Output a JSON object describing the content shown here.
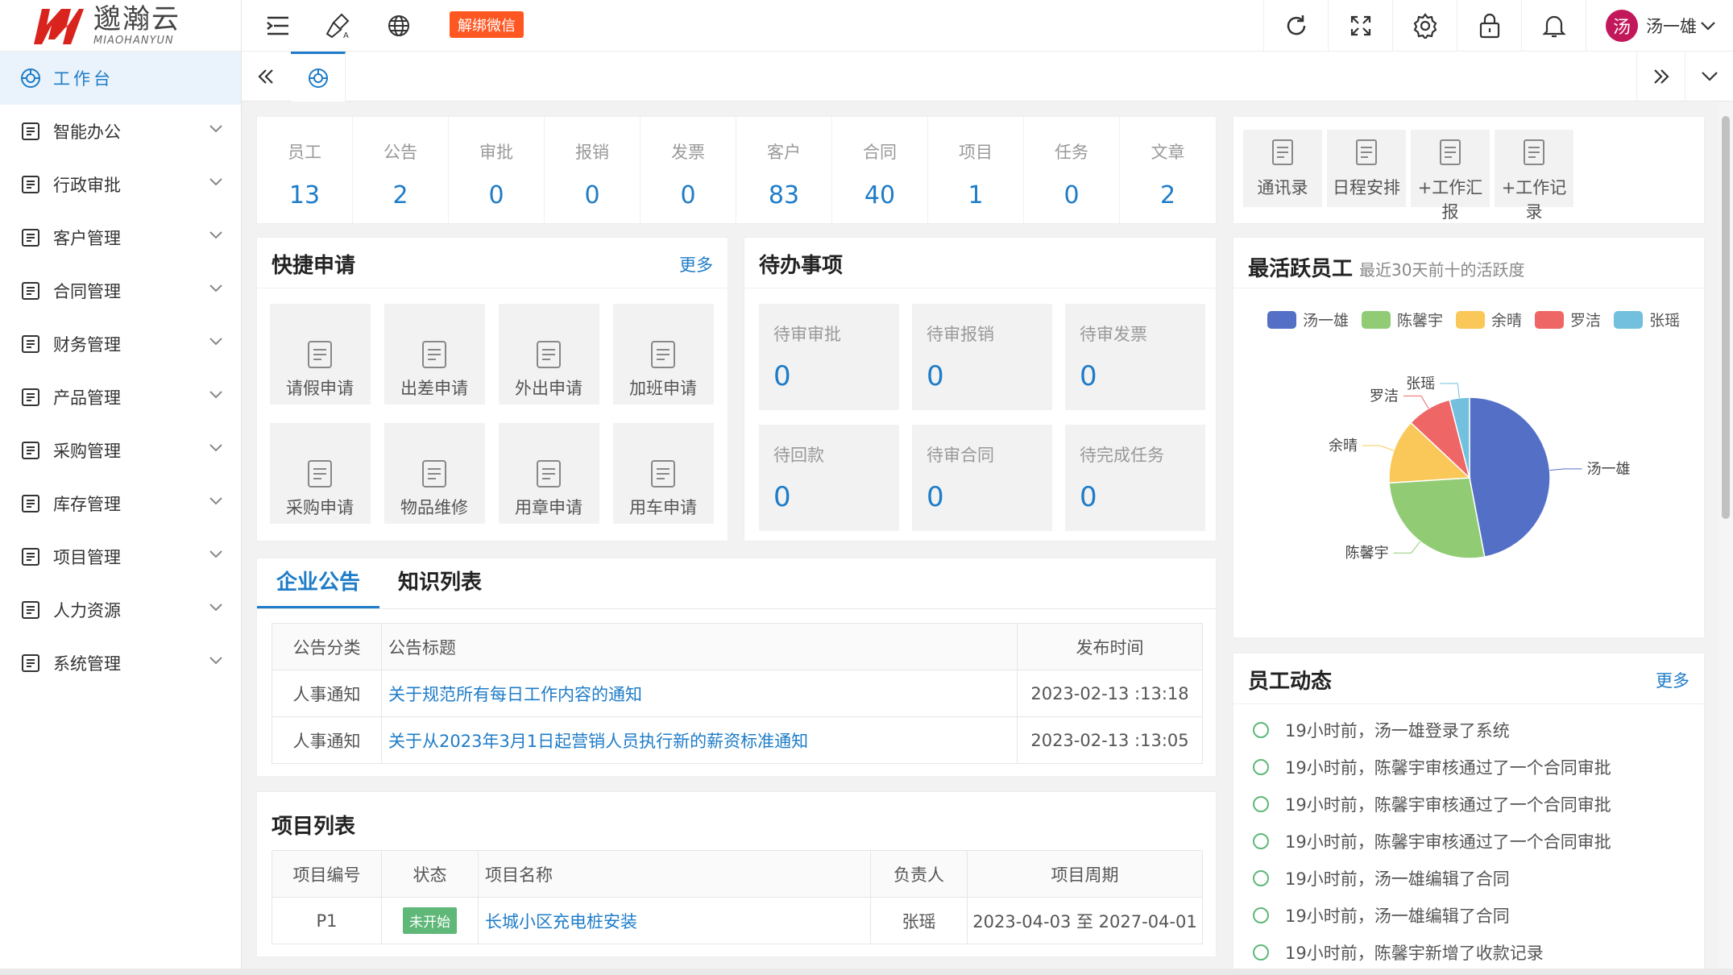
{
  "brand": {
    "name_cn": "邈瀚云",
    "name_en": "MIAOHANYUN",
    "color": "#d9231d"
  },
  "topbar": {
    "unbind_label": "解绑微信",
    "user_name": "汤一雄",
    "avatar_char": "汤"
  },
  "sidebar": {
    "items": [
      {
        "label": "工作台",
        "icon": "dashboard-icon"
      },
      {
        "label": "智能办公",
        "icon": "office-icon"
      },
      {
        "label": "行政审批",
        "icon": "approval-icon"
      },
      {
        "label": "客户管理",
        "icon": "customer-icon"
      },
      {
        "label": "合同管理",
        "icon": "contract-icon"
      },
      {
        "label": "财务管理",
        "icon": "finance-icon"
      },
      {
        "label": "产品管理",
        "icon": "product-icon"
      },
      {
        "label": "采购管理",
        "icon": "purchase-icon"
      },
      {
        "label": "库存管理",
        "icon": "inventory-icon"
      },
      {
        "label": "项目管理",
        "icon": "project-icon"
      },
      {
        "label": "人力资源",
        "icon": "hr-icon"
      },
      {
        "label": "系统管理",
        "icon": "settings-icon"
      }
    ]
  },
  "stats": [
    {
      "label": "员工",
      "value": "13"
    },
    {
      "label": "公告",
      "value": "2"
    },
    {
      "label": "审批",
      "value": "0"
    },
    {
      "label": "报销",
      "value": "0"
    },
    {
      "label": "发票",
      "value": "0"
    },
    {
      "label": "客户",
      "value": "83"
    },
    {
      "label": "合同",
      "value": "40"
    },
    {
      "label": "项目",
      "value": "1"
    },
    {
      "label": "任务",
      "value": "0"
    },
    {
      "label": "文章",
      "value": "2"
    }
  ],
  "quick_tools": [
    {
      "label": "通讯录"
    },
    {
      "label": "日程安排"
    },
    {
      "label": "+工作汇报"
    },
    {
      "label": "+工作记录"
    }
  ],
  "quick_apply": {
    "title": "快捷申请",
    "more": "更多",
    "items": [
      {
        "label": "请假申请"
      },
      {
        "label": "出差申请"
      },
      {
        "label": "外出申请"
      },
      {
        "label": "加班申请"
      },
      {
        "label": "采购申请"
      },
      {
        "label": "物品维修"
      },
      {
        "label": "用章申请"
      },
      {
        "label": "用车申请"
      }
    ]
  },
  "todo": {
    "title": "待办事项",
    "items": [
      {
        "label": "待审审批",
        "value": "0"
      },
      {
        "label": "待审报销",
        "value": "0"
      },
      {
        "label": "待审发票",
        "value": "0"
      },
      {
        "label": "待回款",
        "value": "0"
      },
      {
        "label": "待审合同",
        "value": "0"
      },
      {
        "label": "待完成任务",
        "value": "0"
      }
    ]
  },
  "notice": {
    "tabs": [
      "企业公告",
      "知识列表"
    ],
    "headers": [
      "公告分类",
      "公告标题",
      "发布时间"
    ],
    "rows": [
      {
        "cat": "人事通知",
        "title": "关于规范所有每日工作内容的通知",
        "time": "2023-02-13 :13:18"
      },
      {
        "cat": "人事通知",
        "title": "关于从2023年3月1日起营销人员执行新的薪资标准通知",
        "time": "2023-02-13 :13:05"
      }
    ]
  },
  "projects": {
    "title": "项目列表",
    "headers": [
      "项目编号",
      "状态",
      "项目名称",
      "负责人",
      "项目周期"
    ],
    "rows": [
      {
        "id": "P1",
        "status": "未开始",
        "name": "长城小区充电桩安装",
        "owner": "张瑶",
        "period": "2023-04-03 至 2027-04-01"
      }
    ]
  },
  "chart_data": {
    "type": "pie",
    "title": "最活跃员工",
    "subtitle": "最近30天前十的活跃度",
    "legend_position": "top",
    "series": [
      {
        "name": "汤一雄",
        "value": 47,
        "color": "#5470c6"
      },
      {
        "name": "陈馨宇",
        "value": 27,
        "color": "#91cc75"
      },
      {
        "name": "余晴",
        "value": 13,
        "color": "#fac858"
      },
      {
        "name": "罗洁",
        "value": 9,
        "color": "#ee6666"
      },
      {
        "name": "张瑶",
        "value": 4,
        "color": "#73c0de"
      }
    ]
  },
  "activity": {
    "title": "员工动态",
    "more": "更多",
    "items": [
      "19小时前，汤一雄登录了系统",
      "19小时前，陈馨宇审核通过了一个合同审批",
      "19小时前，陈馨宇审核通过了一个合同审批",
      "19小时前，陈馨宇审核通过了一个合同审批",
      "19小时前，汤一雄编辑了合同",
      "19小时前，汤一雄编辑了合同",
      "19小时前，陈馨宇新增了收款记录"
    ]
  }
}
